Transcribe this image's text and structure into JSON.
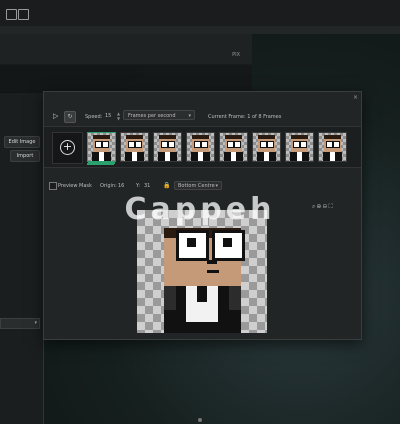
{
  "top_bar": {
    "icons": [
      "folder-icon",
      "laptop-icon"
    ]
  },
  "background_panel": {
    "corner_text": "PIX"
  },
  "left_panel": {
    "edit_image_label": "Edit Image",
    "import_label": "Import"
  },
  "animation_window": {
    "close_glyph": "×",
    "toolbar": {
      "speed_label": "Speed:",
      "speed_value": "15",
      "speed_unit": "Frames per second",
      "current_frame_label": "Current Frame: 1 of 8 Frames"
    },
    "frames": [
      1,
      2,
      3,
      4,
      5,
      6,
      7,
      8
    ],
    "options": {
      "preview_mask_label": "Preview Mask",
      "origin_label": "Origin:",
      "origin_x": "16",
      "origin_y_label": "Y:",
      "origin_y": "31",
      "anchor_value": "Bottom Centre"
    }
  },
  "watermark": "Cappeh",
  "colors": {
    "accent": "#2b9f6e",
    "skin": "#c49a78",
    "hair": "#2a1a10"
  }
}
